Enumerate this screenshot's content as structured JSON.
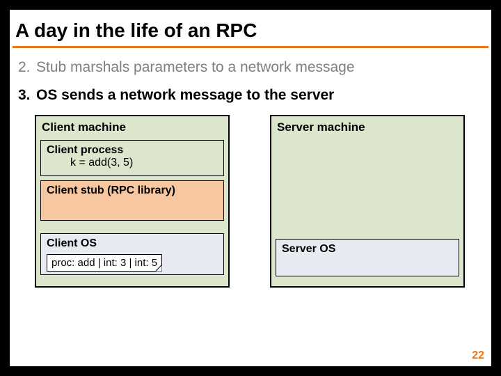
{
  "title": "A day in the life of an RPC",
  "steps": [
    {
      "num": "2.",
      "text": "Stub marshals parameters to a network message",
      "bold": false
    },
    {
      "num": "3.",
      "text": "OS sends a network message to the server",
      "bold": true
    }
  ],
  "client": {
    "label": "Client machine",
    "process": {
      "title": "Client process",
      "call": "k = add(3, 5)"
    },
    "stub": {
      "title": "Client stub (RPC library)"
    },
    "os": {
      "title": "Client OS",
      "message": "proc: add | int: 3 | int: 5"
    }
  },
  "server": {
    "label": "Server machine",
    "os": {
      "title": "Server OS"
    }
  },
  "page_number": "22",
  "colors": {
    "accent": "#e77817"
  }
}
